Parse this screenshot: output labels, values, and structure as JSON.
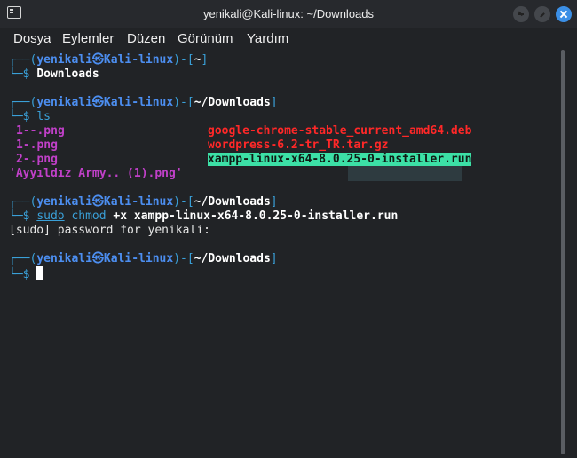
{
  "window": {
    "title": "yenikali@Kali-linux: ~/Downloads"
  },
  "menu": [
    "Dosya",
    "Eylemler",
    "Düzen",
    "Görünüm",
    "Yardım"
  ],
  "prompt": {
    "open": "┌──(",
    "user": "yenikali㉿Kali-linux",
    "mid": ")-[",
    "close": "]",
    "bottom": "└─",
    "dollar": "$"
  },
  "blocks": [
    {
      "dir": "~",
      "command": "Downloads"
    },
    {
      "dir": "~/Downloads",
      "command": "ls"
    },
    {
      "dir": "~/Downloads",
      "command_sudo": "sudo",
      "command_chmod": "chmod",
      "command_args": "+x xampp-linux-x64-8.0.25-0-installer.run"
    },
    {
      "dir": "~/Downloads"
    }
  ],
  "ls_output": {
    "col1": [
      "1--.png",
      "1-.png",
      "2-.png",
      "'Ayyıldız Army.. (1).png'"
    ],
    "col2": [
      "google-chrome-stable_current_amd64.deb",
      "wordpress-6.2-tr_TR.tar.gz",
      "xampp-linux-x64-8.0.25-0-installer.run"
    ]
  },
  "sudo_prompt": "[sudo] password for yenikali:",
  "colors": {
    "accent_blue": "#3b8fe6",
    "prompt_blue": "#3aa0d8",
    "user_blue": "#4c8ef0",
    "png_magenta": "#c040c8",
    "archive_red": "#ff2828",
    "exec_highlight": "#3ce0a6"
  },
  "icons": {
    "titlebar": "terminal-icon",
    "minimize": "minimize-icon",
    "maximize": "maximize-icon",
    "close": "close-icon"
  }
}
